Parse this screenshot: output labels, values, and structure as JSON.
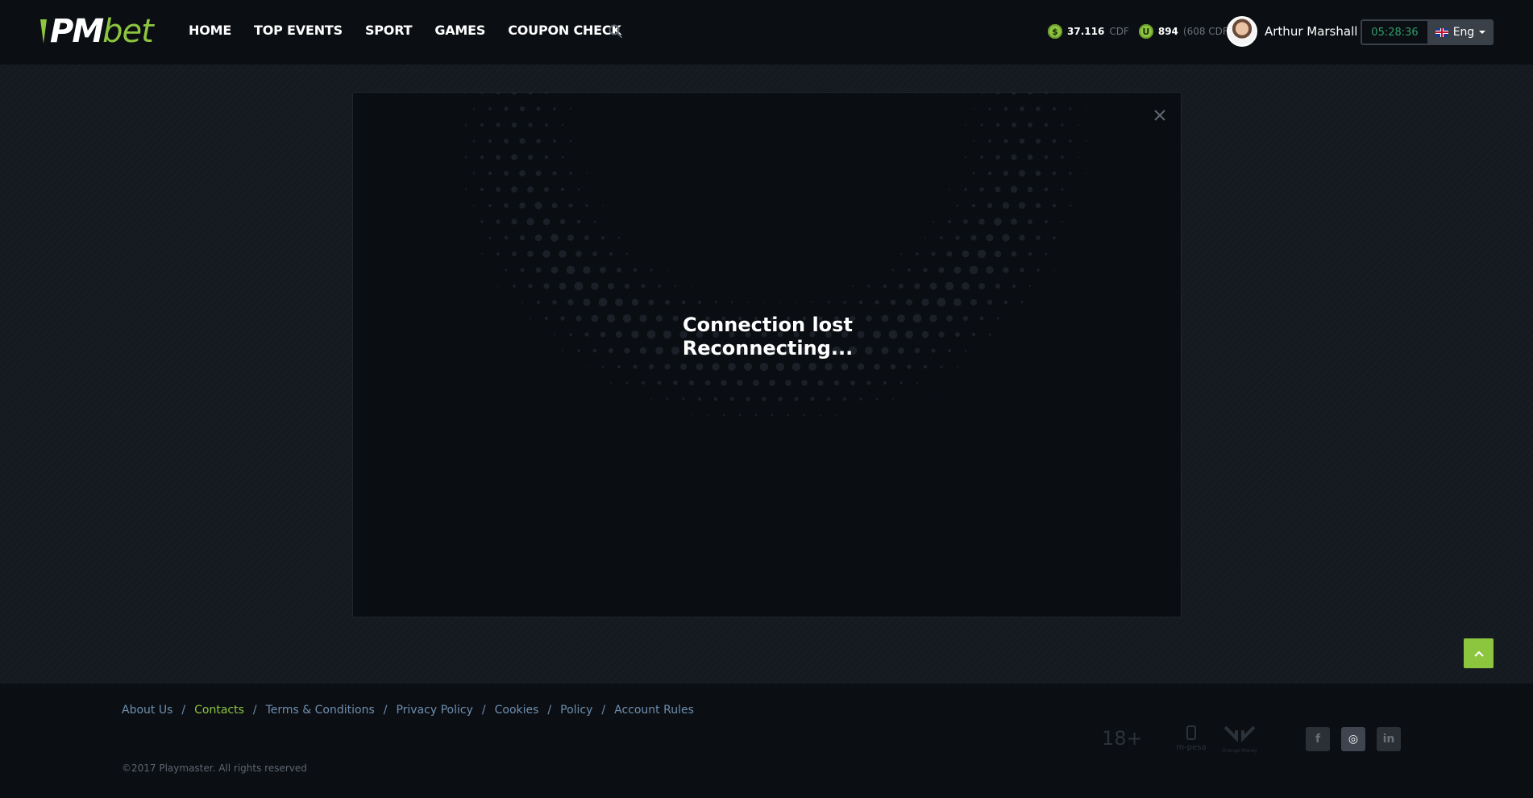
{
  "header": {
    "logo": {
      "pm": "PM",
      "bet": "bet"
    },
    "nav": [
      "HOME",
      "TOP EVENTS",
      "SPORT",
      "GAMES",
      "COUPON CHECK"
    ],
    "balance_main": {
      "icon": "dollar-coin-icon",
      "amount": "37.116",
      "currency": "CDF"
    },
    "balance_bonus": {
      "icon": "bonus-coin-icon",
      "amount": "894",
      "currency": "(608 CDF)"
    },
    "user": {
      "name": "Arthur Marshall"
    },
    "clock": "05:28:36",
    "language": "Eng"
  },
  "modal": {
    "line1": "Connection lost",
    "line2": "Reconnecting..."
  },
  "footer": {
    "links": [
      {
        "label": "About Us",
        "active": false
      },
      {
        "label": "Contacts",
        "active": true
      },
      {
        "label": "Terms & Conditions",
        "active": false
      },
      {
        "label": "Privacy Policy",
        "active": false
      },
      {
        "label": "Cookies",
        "active": false
      },
      {
        "label": "Policy",
        "active": false
      },
      {
        "label": "Account Rules",
        "active": false
      }
    ],
    "copyright": "©2017 Playmaster. All rights reserved",
    "age": "18+",
    "mpesa": "m-pesa",
    "orange": "Orange Money",
    "social": [
      {
        "icon": "facebook-icon",
        "glyph": "f"
      },
      {
        "icon": "instagram-icon",
        "glyph": "◎"
      },
      {
        "icon": "linkedin-icon",
        "glyph": "in"
      }
    ]
  },
  "colors": {
    "accent": "#8cc63f",
    "clock": "#2fa06b",
    "link": "#6f8fb0"
  }
}
